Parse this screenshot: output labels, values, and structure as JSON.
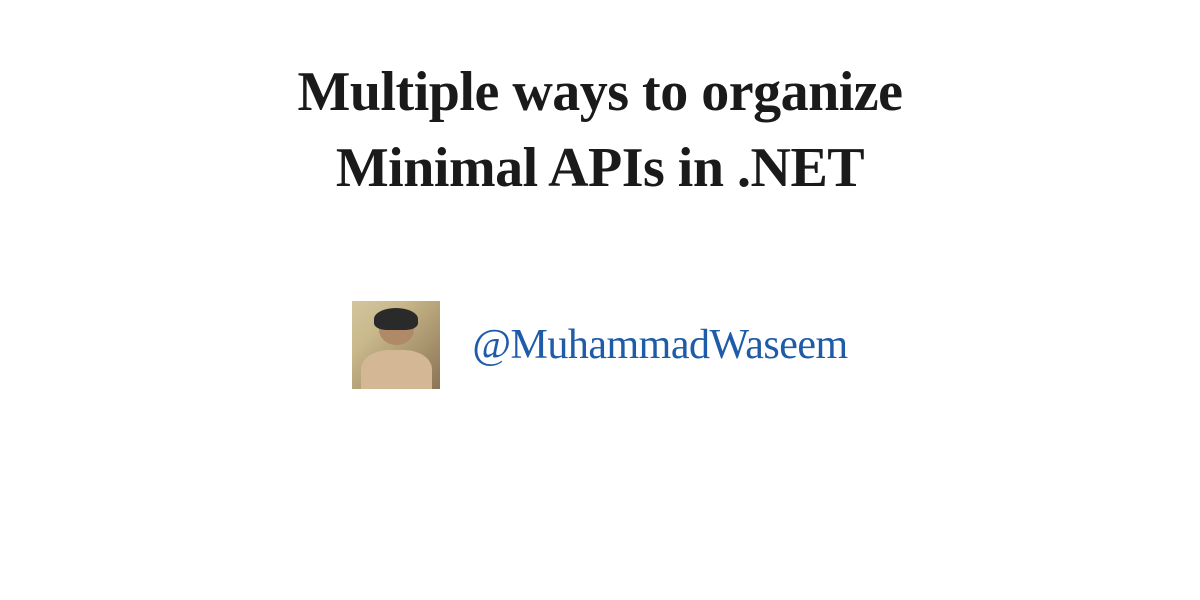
{
  "title_line1": "Multiple ways to organize",
  "title_line2": "Minimal APIs in .NET",
  "author": {
    "handle": "@MuhammadWaseem",
    "avatar_alt": "author-photo"
  },
  "colors": {
    "title": "#1a1a1a",
    "handle": "#1e5ba8",
    "background": "#ffffff"
  }
}
